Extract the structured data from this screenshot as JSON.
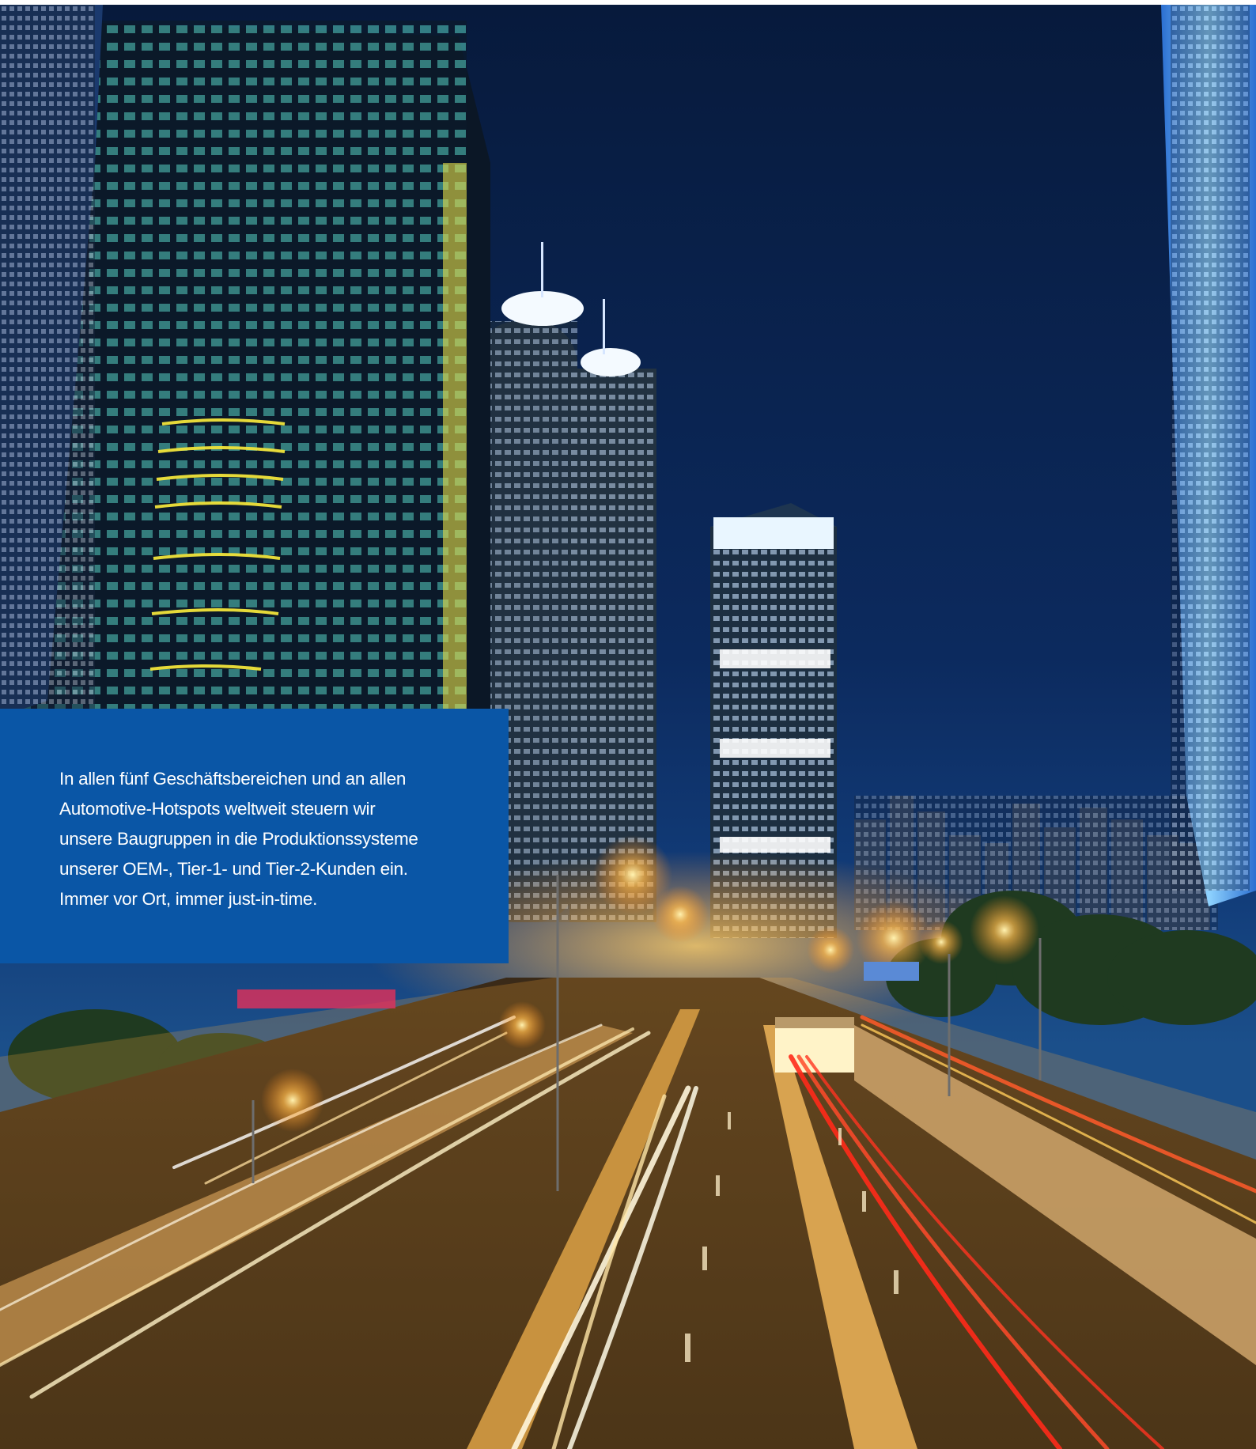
{
  "hero": {
    "image_description_icon": "city-night-skyline-highway-photo"
  },
  "text_panel": {
    "body": "In allen fünf Geschäftsbereichen und an allen\nAutomotive-Hotspots weltweit steuern wir\nunsere Baugruppen in die Produktionssysteme\nunserer OEM-, Tier-1- und Tier-2-Kunden ein.\nImmer vor Ort, immer just-in-time.",
    "background_color": "#0a56a6"
  }
}
